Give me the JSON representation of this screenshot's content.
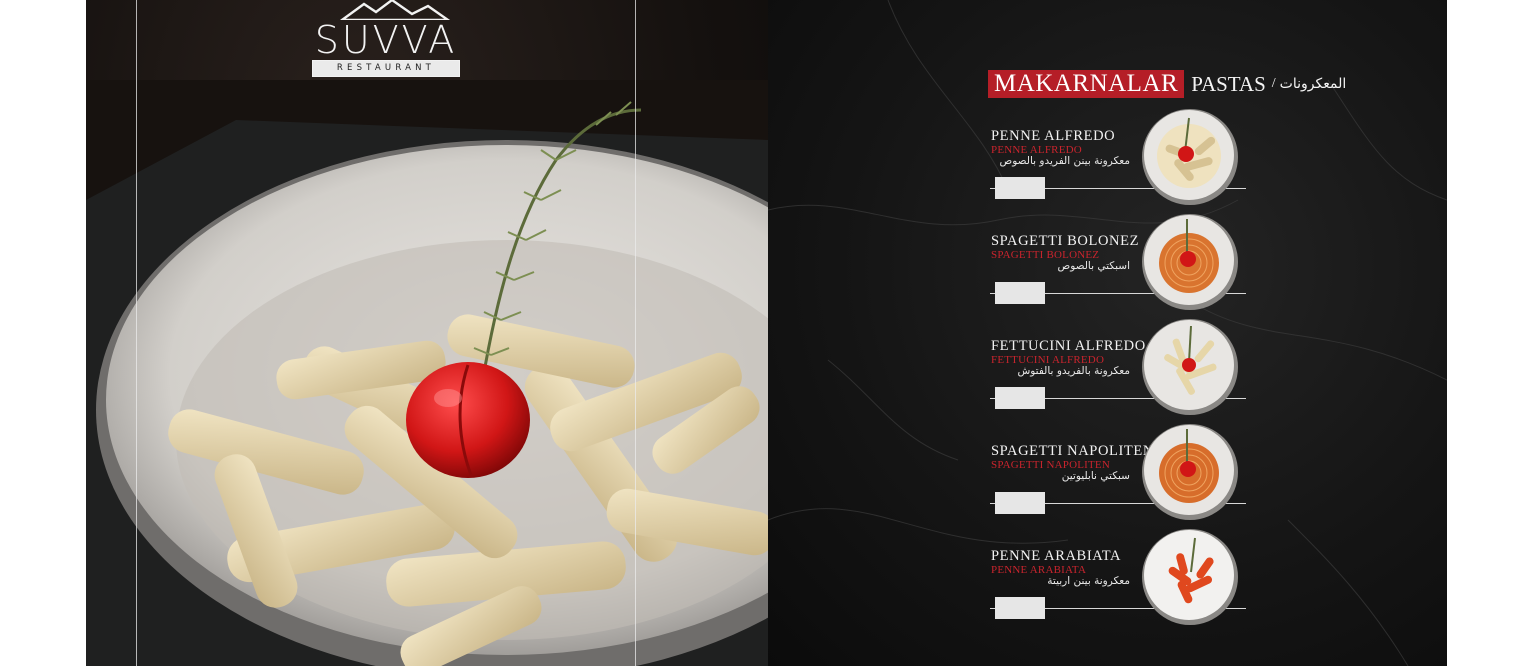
{
  "brand": {
    "name": "SUVVA",
    "tagline": "RESTAURANT"
  },
  "section": {
    "title_tr": "MAKARNALAR",
    "title_en": "PASTAS",
    "separator": "/",
    "title_ar": "المعكرونات"
  },
  "menu_items": [
    {
      "name": "PENNE ALFREDO",
      "subtitle": "PENNE ALFREDO",
      "arabic": "معكرونة بينن الفريدو بالصوص",
      "sauce": "cream"
    },
    {
      "name": "SPAGETTI BOLONEZ",
      "subtitle": "SPAGETTI BOLONEZ",
      "arabic": "اسبكتي بالصوص",
      "sauce": "tomato"
    },
    {
      "name": "FETTUCINI ALFREDO",
      "subtitle": "FETTUCINI ALFREDO",
      "arabic": "معكرونة بالفريدو بالفتوش",
      "sauce": "cream"
    },
    {
      "name": "SPAGETTI NAPOLITEN",
      "subtitle": "SPAGETTI NAPOLITEN",
      "arabic": "سبكتي نابليوتين",
      "sauce": "tomato"
    },
    {
      "name": "PENNE ARABIATA",
      "subtitle": "PENNE ARABIATA",
      "arabic": "معكرونة بينن اربيتة",
      "sauce": "tomato"
    }
  ],
  "colors": {
    "accent_red": "#b51e27",
    "page_dark": "#151515",
    "text_light": "#f2f2f2"
  }
}
